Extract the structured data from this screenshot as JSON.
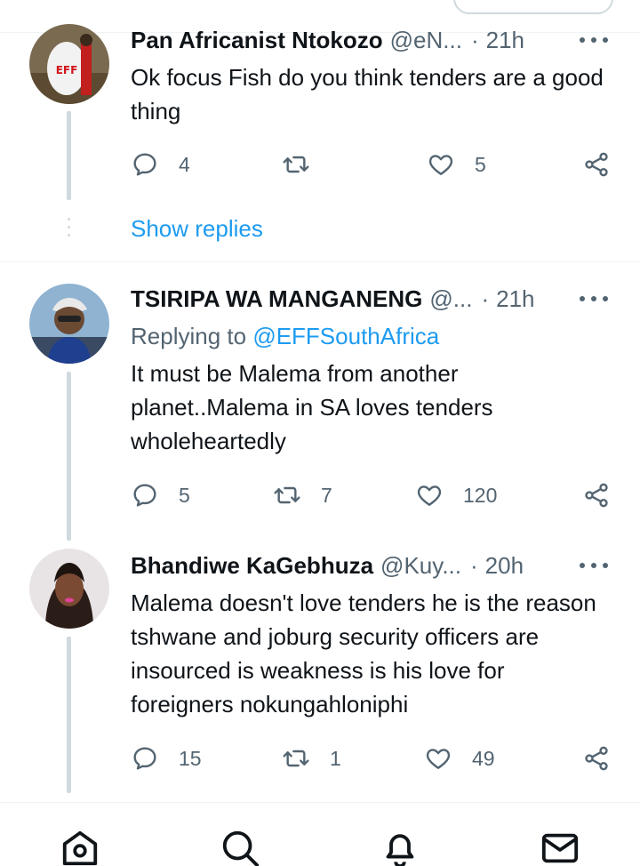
{
  "tweets": [
    {
      "name": "Pan Africanist Ntokozo",
      "handle": "@eN...",
      "dot": "·",
      "time": "21h",
      "text": "Ok focus Fish do you think tenders are a good thing",
      "replies": "4",
      "retweets": "",
      "likes": "5",
      "avatar_icon": "eff-avatar"
    },
    {
      "name": "TSIRIPA WA MANGANENG",
      "handle": "@...",
      "dot": "·",
      "time": "21h",
      "replying_prefix": "Replying to",
      "replying_mention": "@EFFSouthAfrica",
      "text": "It must be Malema from another planet..Malema in SA loves tenders wholeheartedly",
      "replies": "5",
      "retweets": "7",
      "likes": "120",
      "avatar_icon": "man-cap-avatar"
    },
    {
      "name": "Bhandiwe KaGebhuza",
      "handle": "@Kuy...",
      "dot": "·",
      "time": "20h",
      "text": "Malema doesn't love tenders he is the reason tshwane and joburg security officers are insourced is weakness is his love for foreigners nokungahloniphi",
      "replies": "15",
      "retweets": "1",
      "likes": "49",
      "avatar_icon": "woman-avatar"
    }
  ],
  "show_replies": "Show replies",
  "nav": [
    "home-icon",
    "search-icon",
    "notifications-icon",
    "messages-icon"
  ],
  "colors": {
    "accent": "#1d9bf0",
    "secondary_text": "#536471",
    "thread_line": "#cfd9de"
  }
}
